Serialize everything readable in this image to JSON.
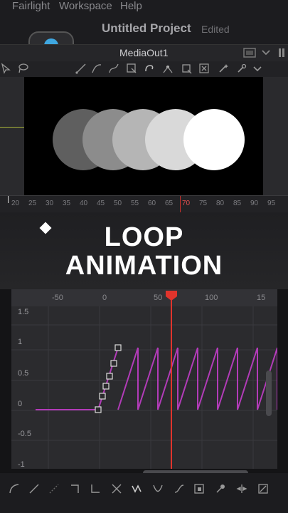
{
  "menu": {
    "items": [
      "Fairlight",
      "Workspace",
      "Help"
    ]
  },
  "title_bar": {
    "project_title": "Untitled Project",
    "status": "Edited"
  },
  "viewer": {
    "name": "MediaOut1"
  },
  "circles": [
    {
      "shade": "#5f5f5f"
    },
    {
      "shade": "#8c8c8c"
    },
    {
      "shade": "#b5b5b5"
    },
    {
      "shade": "#d9d9d9"
    },
    {
      "shade": "#ffffff"
    }
  ],
  "ruler": {
    "ticks": [
      "20",
      "25",
      "30",
      "35",
      "40",
      "45",
      "50",
      "55",
      "60",
      "65",
      "70",
      "75",
      "80",
      "85",
      "90",
      "95"
    ],
    "playhead": "70"
  },
  "overlay": {
    "line1": "LOOP",
    "line2": "ANIMATION"
  },
  "graph": {
    "x_ticks": [
      "-50",
      "0",
      "50",
      "100",
      "15"
    ],
    "y_labels": [
      "1.5",
      "1",
      "0.5",
      "0",
      "-0.5",
      "-1"
    ],
    "curve_color": "#b23bb8",
    "playhead_color": "#e0342c"
  },
  "icons": {
    "toolbar": [
      "pointer-icon",
      "lasso-icon",
      "bezier-icon",
      "polyline-icon",
      "bspline-icon",
      "select-icon",
      "warp-icon",
      "pen-icon",
      "crop-icon",
      "x-icon",
      "magic-icon",
      "settings-icon",
      "chevron-down-icon"
    ],
    "bottom": [
      "curve-icon",
      "line-icon",
      "smooth-icon",
      "step-in-icon",
      "step-out-icon",
      "reverse-icon",
      "loop-icon",
      "pingpong-icon",
      "ease-icon",
      "select-box-icon",
      "key-icon",
      "spread-icon",
      "fit-icon"
    ]
  }
}
